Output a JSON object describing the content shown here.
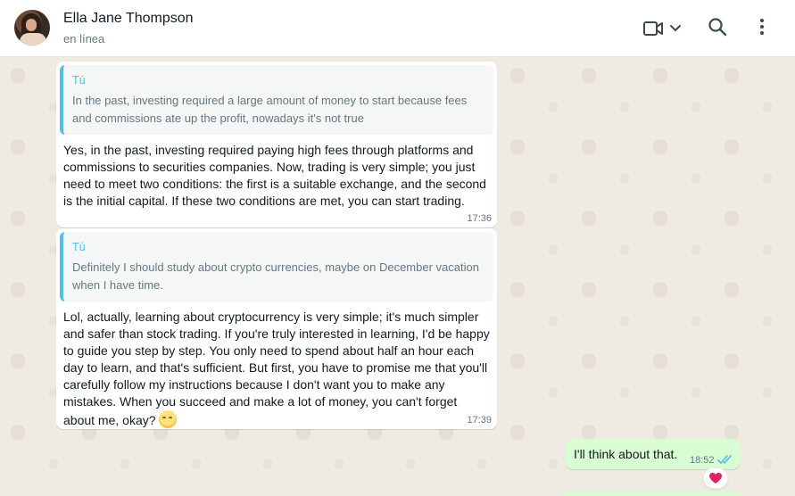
{
  "header": {
    "contact_name": "Ella Jane Thompson",
    "status": "en línea",
    "icons": [
      "video-call-icon",
      "chevron-down-icon",
      "search-icon",
      "more-menu-icon"
    ]
  },
  "colors": {
    "accent": "#53bdeb",
    "outgoing_bubble": "#d9fdd3",
    "chat_bg": "#efeae2",
    "read_ticks": "#53bdeb",
    "reaction_heart": "#e0245e"
  },
  "messages": [
    {
      "quote_author": "Tú",
      "quote_text": "In the past, investing required a large amount of money to start because fees and commissions ate up the profit, nowadays it's not true",
      "text": "Yes, in the past, investing required paying high fees through platforms and commissions to securities companies. Now, trading is very simple; you just need to meet two conditions: the first is a suitable exchange, and the second is the initial capital. If these two conditions are met, you can start trading.",
      "time": "17:36"
    },
    {
      "quote_author": "Tú",
      "quote_text": "Definitely I should study about crypto currencies, maybe on December vacation when I have time.",
      "text": "Lol, actually, learning about cryptocurrency is very simple; it's much simpler and safer than stock trading. If you're truly interested in learning, I'd be happy to guide you step by step. You only need to spend about half an hour each day to learn, and that's sufficient. But first, you have to promise me that you'll carefully follow my instructions because I don't want you to make any mistakes. When you succeed and make a lot of money, you can't forget about me, okay?",
      "emoji": "relieved-face-emoji",
      "time": "17:39"
    }
  ],
  "outgoing": {
    "text": "I'll think about that.",
    "time": "18:52",
    "status_icon": "double-check-read-icon",
    "reaction": "red-heart-icon"
  }
}
